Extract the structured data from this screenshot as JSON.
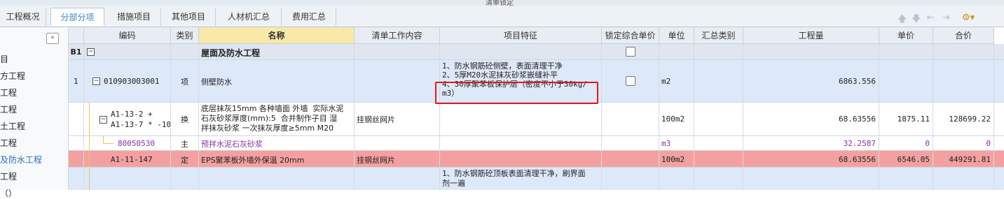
{
  "window": {
    "title": "清单锁定"
  },
  "tabs": [
    "工程概况",
    "分部分项",
    "措施项目",
    "其他项目",
    "人材机汇总",
    "费用汇总"
  ],
  "toolbar_icons": [
    "move-up-icon",
    "move-down-icon",
    "move-top-icon",
    "move-bottom-icon",
    "settings-icon"
  ],
  "sidebar": {
    "collapse_label": "«",
    "items": [
      "目",
      "方工程",
      "工程",
      "工程",
      "土工程",
      "工程",
      "及防水工程",
      "工程",
      "（）"
    ]
  },
  "columns": [
    "编码",
    "类别",
    "名称",
    "清单工作内容",
    "项目特征",
    "锁定综合单价",
    "单位",
    "汇总类别",
    "工程量",
    "单价",
    "合价"
  ],
  "rows": [
    {
      "rownum": "B1",
      "code": "",
      "type": "",
      "name": "屋面及防水工程",
      "work": "",
      "feature": "",
      "unit": "",
      "qty": "",
      "price": "",
      "total": ""
    },
    {
      "rownum": "1",
      "code": "010903003001",
      "type": "项",
      "name": "侧壁防水",
      "work": "",
      "feature": "1、防水钢筋砼侧壁，表面清理干净\n2、5厚M20水泥抹灰砂浆嵌缝补平\n4、30厚聚苯板保护层（密度不小于30kg/\nm3）",
      "unit": "m2",
      "qty": "6863.556",
      "price": "",
      "total": ""
    },
    {
      "rownum": "",
      "code": "A1-13-2 +\nA1-13-7 * -10",
      "type": "换",
      "name": "底层抹灰15mm 各种墙面 外墙  实际水泥\n石灰砂浆厚度(mm):5  合并制作子目 湿\n拌抹灰砂浆 一次抹灰厚度≥5mm M20",
      "work": "挂钢丝网片",
      "feature": "",
      "unit": "100m2",
      "qty": "68.63556",
      "price": "1875.11",
      "total": "128699.22"
    },
    {
      "rownum": "",
      "code": "80050530",
      "type": "主",
      "name": "预拌水泥石灰砂浆",
      "work": "",
      "feature": "",
      "unit": "m3",
      "qty": "32.2587",
      "price": "0",
      "total": "0"
    },
    {
      "rownum": "",
      "code": "A1-11-147",
      "type": "定",
      "name": "EPS聚苯板外墙外保温 20mm",
      "work": "挂钢丝网片",
      "feature": "",
      "unit": "100m2",
      "qty": "68.63556",
      "price": "6546.05",
      "total": "449291.81"
    },
    {
      "rownum": "",
      "code": "",
      "type": "",
      "name": "",
      "work": "",
      "feature": "1、防水钢筋砼顶板表面清理干净，刷界面\n剂一遍",
      "unit": "",
      "qty": "",
      "price": "",
      "total": ""
    }
  ],
  "tree_toggle": "−",
  "colors": {
    "accent": "#3a82c9",
    "highlight_row": "#f4a0a0",
    "selected_row": "#dde8f8",
    "purple": "#8a2fa8",
    "red_annotation": "#e01a1a"
  }
}
